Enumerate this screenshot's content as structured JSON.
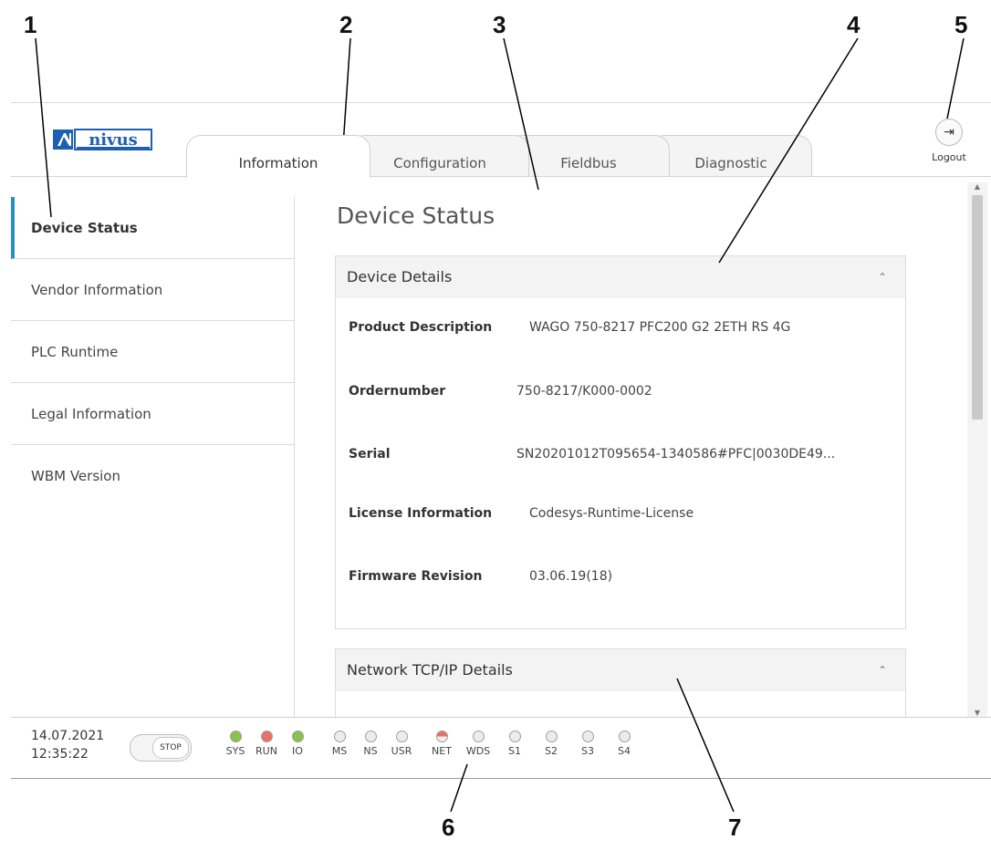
{
  "callouts": [
    "1",
    "2",
    "3",
    "4",
    "5",
    "6",
    "7"
  ],
  "tabs": [
    {
      "label": "Information",
      "active": true
    },
    {
      "label": "Configuration",
      "active": false
    },
    {
      "label": "Fieldbus",
      "active": false
    },
    {
      "label": "Diagnostic",
      "active": false
    }
  ],
  "brand": {
    "logo_text": "nivus",
    "color": "#1d5fb0"
  },
  "logout": {
    "label": "Logout",
    "icon": "logout-icon"
  },
  "sidebar": {
    "active_color": "#2a8ec7",
    "items": [
      {
        "label": "Device Status",
        "active": true
      },
      {
        "label": "Vendor Information",
        "active": false
      },
      {
        "label": "PLC Runtime",
        "active": false
      },
      {
        "label": "Legal Information",
        "active": false
      },
      {
        "label": "WBM Version",
        "active": false
      }
    ]
  },
  "main": {
    "title": "Device Status",
    "device_details": {
      "header": "Device Details",
      "rows": [
        {
          "label": "Product Description",
          "value": "WAGO 750-8217 PFC200 G2 2ETH RS 4G"
        },
        {
          "label": "Ordernumber",
          "value": "750-8217/K000-0002"
        },
        {
          "label": "Serial",
          "value": "SN20201012T095654-1340586#PFC|0030DE49..."
        },
        {
          "label": "License Information",
          "value": "Codesys-Runtime-License"
        },
        {
          "label": "Firmware Revision",
          "value": "03.06.19(18)"
        }
      ]
    },
    "network": {
      "header": "Network TCP/IP Details"
    }
  },
  "status": {
    "date": "14.07.2021",
    "time": "12:35:22",
    "stop_label": "STOP",
    "leds": [
      {
        "name": "SYS",
        "color": "#8bc34a"
      },
      {
        "name": "RUN",
        "color": "#e57368"
      },
      {
        "name": "IO",
        "color": "#8bc34a"
      },
      {
        "name": "MS",
        "color": "#ececec"
      },
      {
        "name": "NS",
        "color": "#ececec"
      },
      {
        "name": "USR",
        "color": "#ececec"
      },
      {
        "name": "NET",
        "color": "#e57368",
        "half": true
      },
      {
        "name": "WDS",
        "color": "#ececec"
      },
      {
        "name": "S1",
        "color": "#ececec"
      },
      {
        "name": "S2",
        "color": "#ececec"
      },
      {
        "name": "S3",
        "color": "#ececec"
      },
      {
        "name": "S4",
        "color": "#ececec"
      }
    ]
  }
}
